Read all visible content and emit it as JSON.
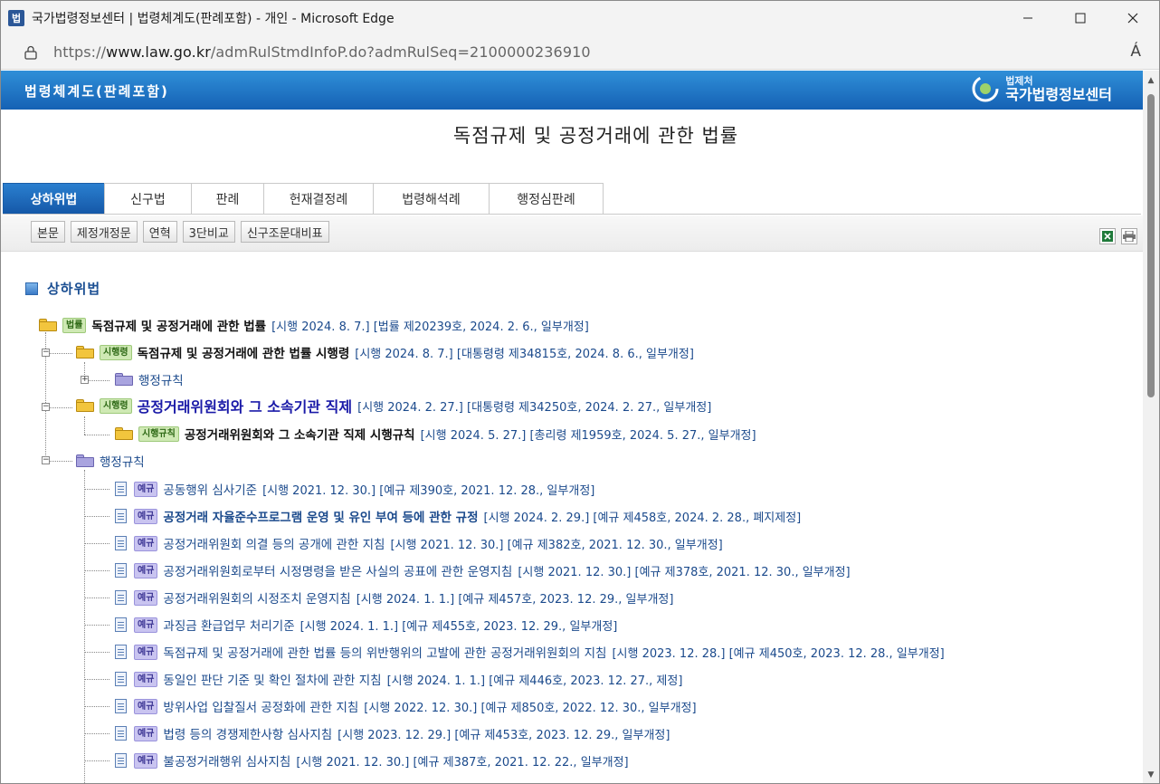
{
  "window": {
    "app_icon_text": "법",
    "title": "국가법령정보센터 | 법령체계도(판례포함) - 개인 - Microsoft Edge"
  },
  "address": {
    "url_prefix": "https://",
    "url_host": "www.law.go.kr",
    "url_path": "/admRulStmdInfoP.do?admRulSeq=2100000236910",
    "read_aloud_label": "Á"
  },
  "header": {
    "title": "법령체계도(판례포함)",
    "brand_small": "법제처",
    "brand_main": "국가법령정보센터"
  },
  "doc_title": "독점규제 및 공정거래에 관한 법률",
  "tabs": [
    {
      "label": "상하위법",
      "active": true
    },
    {
      "label": "신구법"
    },
    {
      "label": "판례"
    },
    {
      "label": "헌재결정례"
    },
    {
      "label": "법령해석례"
    },
    {
      "label": "행정심판례"
    }
  ],
  "sub_buttons": [
    "본문",
    "제정개정문",
    "연혁",
    "3단비교",
    "신구조문대비표"
  ],
  "section_title": "상하위법",
  "tree": [
    {
      "badge": "법률",
      "name": "독점규제 및 공정거래에 관한 법률",
      "meta": "[시행 2024. 8. 7.] [법률 제20239호, 2024. 2. 6., 일부개정]"
    },
    {
      "badge": "시행령",
      "name": "독점규제 및 공정거래에 관한 법률 시행령",
      "meta": "[시행 2024. 8. 7.] [대통령령 제34815호, 2024. 8. 6., 일부개정]"
    },
    {
      "name": "행정규칙"
    },
    {
      "badge": "시행령",
      "name": "공정거래위원회와 그 소속기관 직제",
      "meta": "[시행 2024. 2. 27.] [대통령령 제34250호, 2024. 2. 27., 일부개정]"
    },
    {
      "badge": "시행규칙",
      "name": "공정거래위원회와 그 소속기관 직제 시행규칙",
      "meta": "[시행 2024. 5. 27.] [총리령 제1959호, 2024. 5. 27., 일부개정]"
    },
    {
      "name": "행정규칙"
    }
  ],
  "rules": [
    {
      "badge": "예규",
      "name": "공동행위 심사기준",
      "meta": "[시행 2021. 12. 30.] [예규 제390호, 2021. 12. 28., 일부개정]"
    },
    {
      "badge": "예규",
      "name": "공정거래 자율준수프로그램 운영 및 유인 부여 등에 관한 규정",
      "meta": "[시행 2024. 2. 29.] [예규 제458호, 2024. 2. 28., 폐지제정]"
    },
    {
      "badge": "예규",
      "name": "공정거래위원회 의결 등의 공개에 관한 지침",
      "meta": "[시행 2021. 12. 30.] [예규 제382호, 2021. 12. 30., 일부개정]"
    },
    {
      "badge": "예규",
      "name": "공정거래위원회로부터 시정명령을 받은 사실의 공표에 관한 운영지침",
      "meta": "[시행 2021. 12. 30.] [예규 제378호, 2021. 12. 30., 일부개정]"
    },
    {
      "badge": "예규",
      "name": "공정거래위원회의 시정조치 운영지침",
      "meta": "[시행 2024. 1. 1.] [예규 제457호, 2023. 12. 29., 일부개정]"
    },
    {
      "badge": "예규",
      "name": "과징금 환급업무 처리기준",
      "meta": "[시행 2024. 1. 1.] [예규 제455호, 2023. 12. 29., 일부개정]"
    },
    {
      "badge": "예규",
      "name": "독점규제 및 공정거래에 관한 법률 등의 위반행위의 고발에 관한 공정거래위원회의 지침",
      "meta": "[시행 2023. 12. 28.] [예규 제450호, 2023. 12. 28., 일부개정]"
    },
    {
      "badge": "예규",
      "name": "동일인 판단 기준 및 확인 절차에 관한 지침",
      "meta": "[시행 2024. 1. 1.] [예규 제446호, 2023. 12. 27., 제정]"
    },
    {
      "badge": "예규",
      "name": "방위사업 입찰질서 공정화에 관한 지침",
      "meta": "[시행 2022. 12. 30.] [예규 제850호, 2022. 12. 30., 일부개정]"
    },
    {
      "badge": "예규",
      "name": "법령 등의 경쟁제한사항 심사지침",
      "meta": "[시행 2023. 12. 29.] [예규 제453호, 2023. 12. 29., 일부개정]"
    },
    {
      "badge": "예규",
      "name": "불공정거래행위 심사지침",
      "meta": "[시행 2021. 12. 30.] [예규 제387호, 2021. 12. 22., 일부개정]"
    }
  ]
}
